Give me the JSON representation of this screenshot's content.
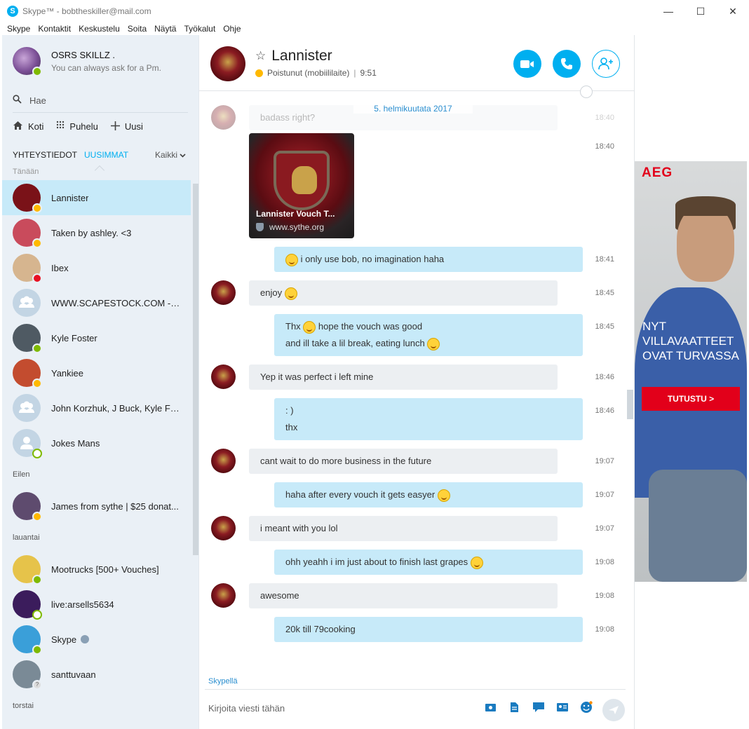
{
  "window": {
    "title": "Skype™ - bobtheskiller@mail.com",
    "logo_letter": "S",
    "controls": {
      "minimize": "—",
      "maximize": "☐",
      "close": "✕"
    }
  },
  "menu": [
    "Skype",
    "Kontaktit",
    "Keskustelu",
    "Soita",
    "Näytä",
    "Työkalut",
    "Ohje"
  ],
  "profile": {
    "name": "OSRS SKILLZ .",
    "mood": "You can always ask for a Pm."
  },
  "search": {
    "label": "Hae"
  },
  "nav": {
    "home": "Koti",
    "call": "Puhelu",
    "new": "Uusi"
  },
  "filters": {
    "contacts": "YHTEYSTIEDOT",
    "recent": "UUSIMMAT",
    "all": "Kaikki"
  },
  "sections": {
    "today": "Tänään",
    "yesterday": "Eilen",
    "saturday": "lauantai",
    "thursday": "torstai"
  },
  "contacts_today": [
    {
      "name": "Lannister",
      "status": "away",
      "color": "#7a1218"
    },
    {
      "name": "Taken by ashley. <3",
      "status": "away",
      "color": "#c94b5c"
    },
    {
      "name": "Ibex",
      "status": "dnd",
      "color": "#d6b58f"
    },
    {
      "name": "WWW.SCAPESTOCK.COM -RS...",
      "status": "group",
      "color": "#c3d5e4"
    },
    {
      "name": "Kyle Foster",
      "status": "online",
      "color": "#4f5a63"
    },
    {
      "name": "Yankiee",
      "status": "away",
      "color": "#c34c2f"
    },
    {
      "name": "John Korzhuk, J Buck, Kyle Fos...",
      "status": "group",
      "color": "#c3d5e4"
    },
    {
      "name": "Jokes Mans",
      "status": "offline",
      "color": "#c3d5e4"
    }
  ],
  "contacts_yesterday": [
    {
      "name": "James from sythe | $25 donat...",
      "status": "away",
      "color": "#5e4b6e"
    }
  ],
  "contacts_saturday": [
    {
      "name": "Mootrucks [500+ Vouches]",
      "status": "online",
      "color": "#e6c34a"
    },
    {
      "name": "live:arsells5634",
      "status": "offline",
      "color": "#3b1c5c"
    },
    {
      "name": "Skype",
      "status": "online",
      "color": "#3a9fd9"
    },
    {
      "name": "santtuvaan",
      "status": "unknown",
      "color": "#7a8a96"
    }
  ],
  "chat": {
    "name": "Lannister",
    "status": "Poistunut (mobiililaite)",
    "time": "9:51",
    "date": "5. helmikuutata 2017",
    "partial_text": "badass right?",
    "partial_time": "18:40",
    "link": {
      "title": "Lannister Vouch T...",
      "url": "www.sythe.org",
      "time": "18:40"
    },
    "messages": [
      {
        "dir": "out",
        "lines": [
          "i only use bob, no imagination haha"
        ],
        "time": "18:41"
      },
      {
        "dir": "in",
        "lines": [
          "enjoy"
        ],
        "time": "18:45"
      },
      {
        "dir": "out",
        "lines": [
          "Thx",
          "hope the vouch was good",
          "and ill take a lil break, eating lunch"
        ],
        "time": "18:45"
      },
      {
        "dir": "in",
        "lines": [
          "Yep it was perfect i left mine"
        ],
        "time": "18:46"
      },
      {
        "dir": "out",
        "lines": [
          ": )",
          "thx"
        ],
        "time": "18:46"
      },
      {
        "dir": "in",
        "lines": [
          "cant wait to do more business in the future"
        ],
        "time": "19:07"
      },
      {
        "dir": "out",
        "lines": [
          "haha after every vouch it gets easyer"
        ],
        "time": "19:07"
      },
      {
        "dir": "in",
        "lines": [
          "i meant with you lol"
        ],
        "time": "19:07"
      },
      {
        "dir": "out",
        "lines": [
          "ohh yeahh i im just about to finish last grapes"
        ],
        "time": "19:08"
      },
      {
        "dir": "in",
        "lines": [
          "awesome"
        ],
        "time": "19:08"
      },
      {
        "dir": "out",
        "lines": [
          "20k till 79cooking"
        ],
        "time": "19:08"
      }
    ]
  },
  "compose": {
    "via": "Skypellä",
    "placeholder": "Kirjoita viesti tähän"
  },
  "ad": {
    "brand": "AEG",
    "headline_1": "NYT",
    "headline_2": "VILLAVAATTEET",
    "headline_3": "OVAT TURVASSA",
    "cta": "TUTUSTU >"
  }
}
